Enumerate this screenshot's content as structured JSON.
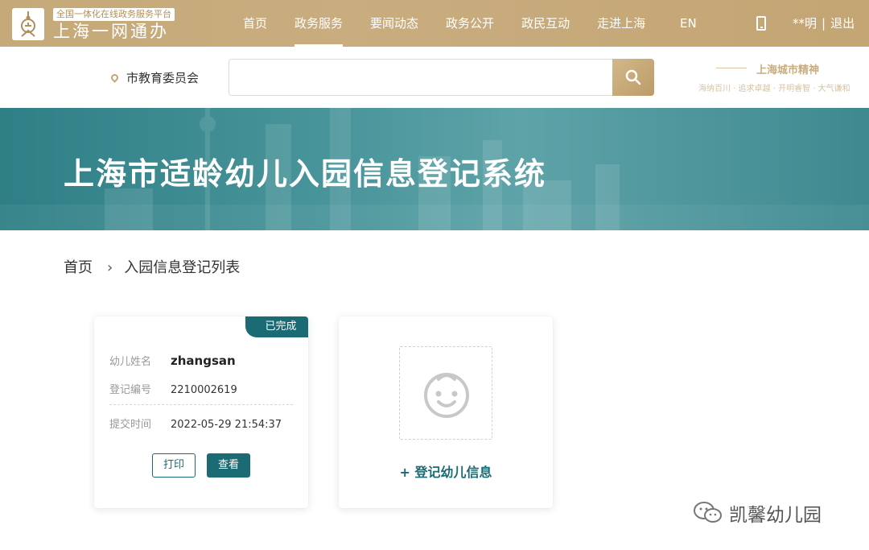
{
  "header": {
    "logo_tagline": "全国一体化在线政务服务平台",
    "logo_name": "上海一网通办",
    "nav": [
      "首页",
      "政务服务",
      "要闻动态",
      "政务公开",
      "政民互动",
      "走进上海"
    ],
    "active_nav": "政务服务",
    "lang": "EN",
    "user": "**明",
    "logout": "退出"
  },
  "search": {
    "location": "市教育委员会",
    "placeholder": ""
  },
  "city_spirit": {
    "title": "上海城市精神",
    "subtitle": "海纳百川 · 追求卓越 · 开明睿智 · 大气谦和"
  },
  "banner": {
    "title": "上海市适龄幼儿入园信息登记系统"
  },
  "breadcrumb": {
    "home": "首页",
    "separator": "›",
    "current": "入园信息登记列表"
  },
  "record_card": {
    "status": "已完成",
    "name_label": "幼儿姓名",
    "name_value": "zhangsan",
    "id_label": "登记编号",
    "id_value": "2210002619",
    "time_label": "提交时间",
    "time_value": "2022-05-29 21:54:37",
    "print_label": "打印",
    "view_label": "查看"
  },
  "add_card": {
    "label": "+ 登记幼儿信息"
  },
  "watermark": {
    "text": "凯馨幼儿园"
  },
  "colors": {
    "gold": "#c6a978",
    "teal": "#1a6b73",
    "banner": "#4a969c"
  }
}
